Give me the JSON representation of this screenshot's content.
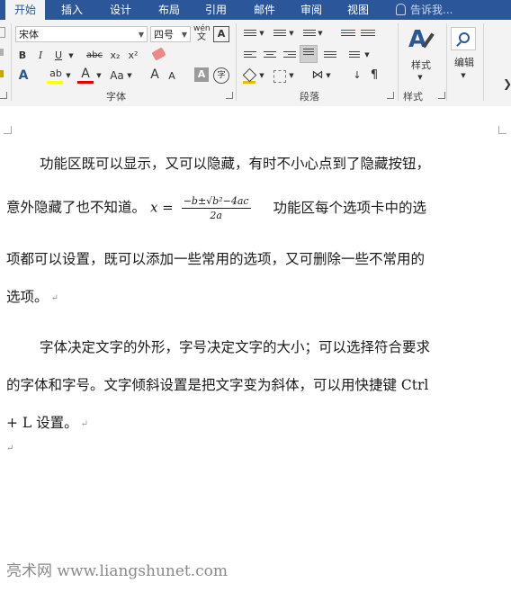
{
  "tabs": [
    {
      "label": "开始",
      "active": true
    },
    {
      "label": "插入"
    },
    {
      "label": "设计"
    },
    {
      "label": "布局"
    },
    {
      "label": "引用"
    },
    {
      "label": "邮件"
    },
    {
      "label": "审阅"
    },
    {
      "label": "视图"
    }
  ],
  "tell_me": "告诉我...",
  "font_group": {
    "label": "字体",
    "font_name": "宋体",
    "font_size": "四号",
    "wen_top": "wén",
    "wen_bottom": "文",
    "boxed_a": "A",
    "bold": "B",
    "italic": "I",
    "underline": "U",
    "strike": "abc",
    "subscript": "x₂",
    "superscript": "x²",
    "text_effects": "A",
    "highlight": "ab",
    "font_color": "A",
    "change_case": "Aa",
    "grow": "A",
    "shrink": "A",
    "shading_a": "A",
    "enclose": "字"
  },
  "paragraph_group": {
    "label": "段落"
  },
  "styles_group": {
    "label": "样式",
    "styles_button": "样式"
  },
  "editing": {
    "label": "编辑"
  },
  "document": {
    "para1_line1": "功能区既可以显示，又可以隐藏，有时不小心点到了隐藏按钮，",
    "para1_line2_before": "意外隐藏了也不知道。",
    "formula_lhs": "x =",
    "formula_num": "−b±√b²−4ac",
    "formula_den": "2a",
    "para1_line2_after": "功能区每个选项卡中的选",
    "para1_line3": "项都可以设置，既可以添加一些常用的选项，又可删除一些不常用的",
    "para1_line4": "选项。",
    "para2_line1": "字体决定文字的外形，字号决定文字的大小；可以选择符合要求",
    "para2_line2": "的字体和字号。文字倾斜设置是把文字变为斜体，可以用快捷键 Ctrl",
    "para2_line3": "+ L 设置。",
    "paragraph_mark": "↵"
  },
  "watermark": "亮术网 www.liangshunet.com",
  "colors": {
    "tab_bar": "#2b579a",
    "highlight": "#ffff00",
    "font_color": "#e00000"
  }
}
